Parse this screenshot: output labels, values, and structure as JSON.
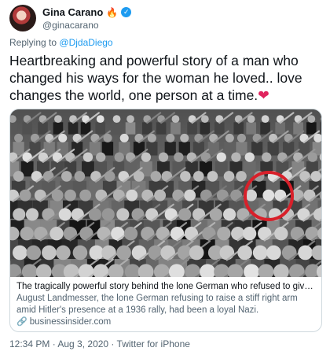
{
  "author": {
    "name": "Gina Carano",
    "torch_glyph": "🔥",
    "handle": "@ginacarano",
    "verified_glyph": "✓"
  },
  "reply": {
    "prefix": "Replying to",
    "mention": "@DjdaDiego"
  },
  "tweet": {
    "text": "Heartbreaking and powerful story of a man who changed his ways for the woman he loved.. love changes the world, one person at a time.",
    "emoji": "❤"
  },
  "card": {
    "title": "The tragically powerful story behind the lone German who refused to give Hitler ...",
    "description": "August Landmesser, the lone German refusing to raise a stiff right arm amid Hitler's presence at a 1936 rally, had been a loyal Nazi.",
    "link_glyph": "🔗",
    "domain": "businessinsider.com",
    "image_icon": "crowd-photo",
    "highlight_color": "#d8202a"
  },
  "meta": {
    "timestamp": "12:34 PM · Aug 3, 2020 · Twitter for iPhone"
  },
  "colors": {
    "accent": "#1d9bf0",
    "text": "#0f1419",
    "muted": "#536471",
    "heart": "#e0245e"
  }
}
